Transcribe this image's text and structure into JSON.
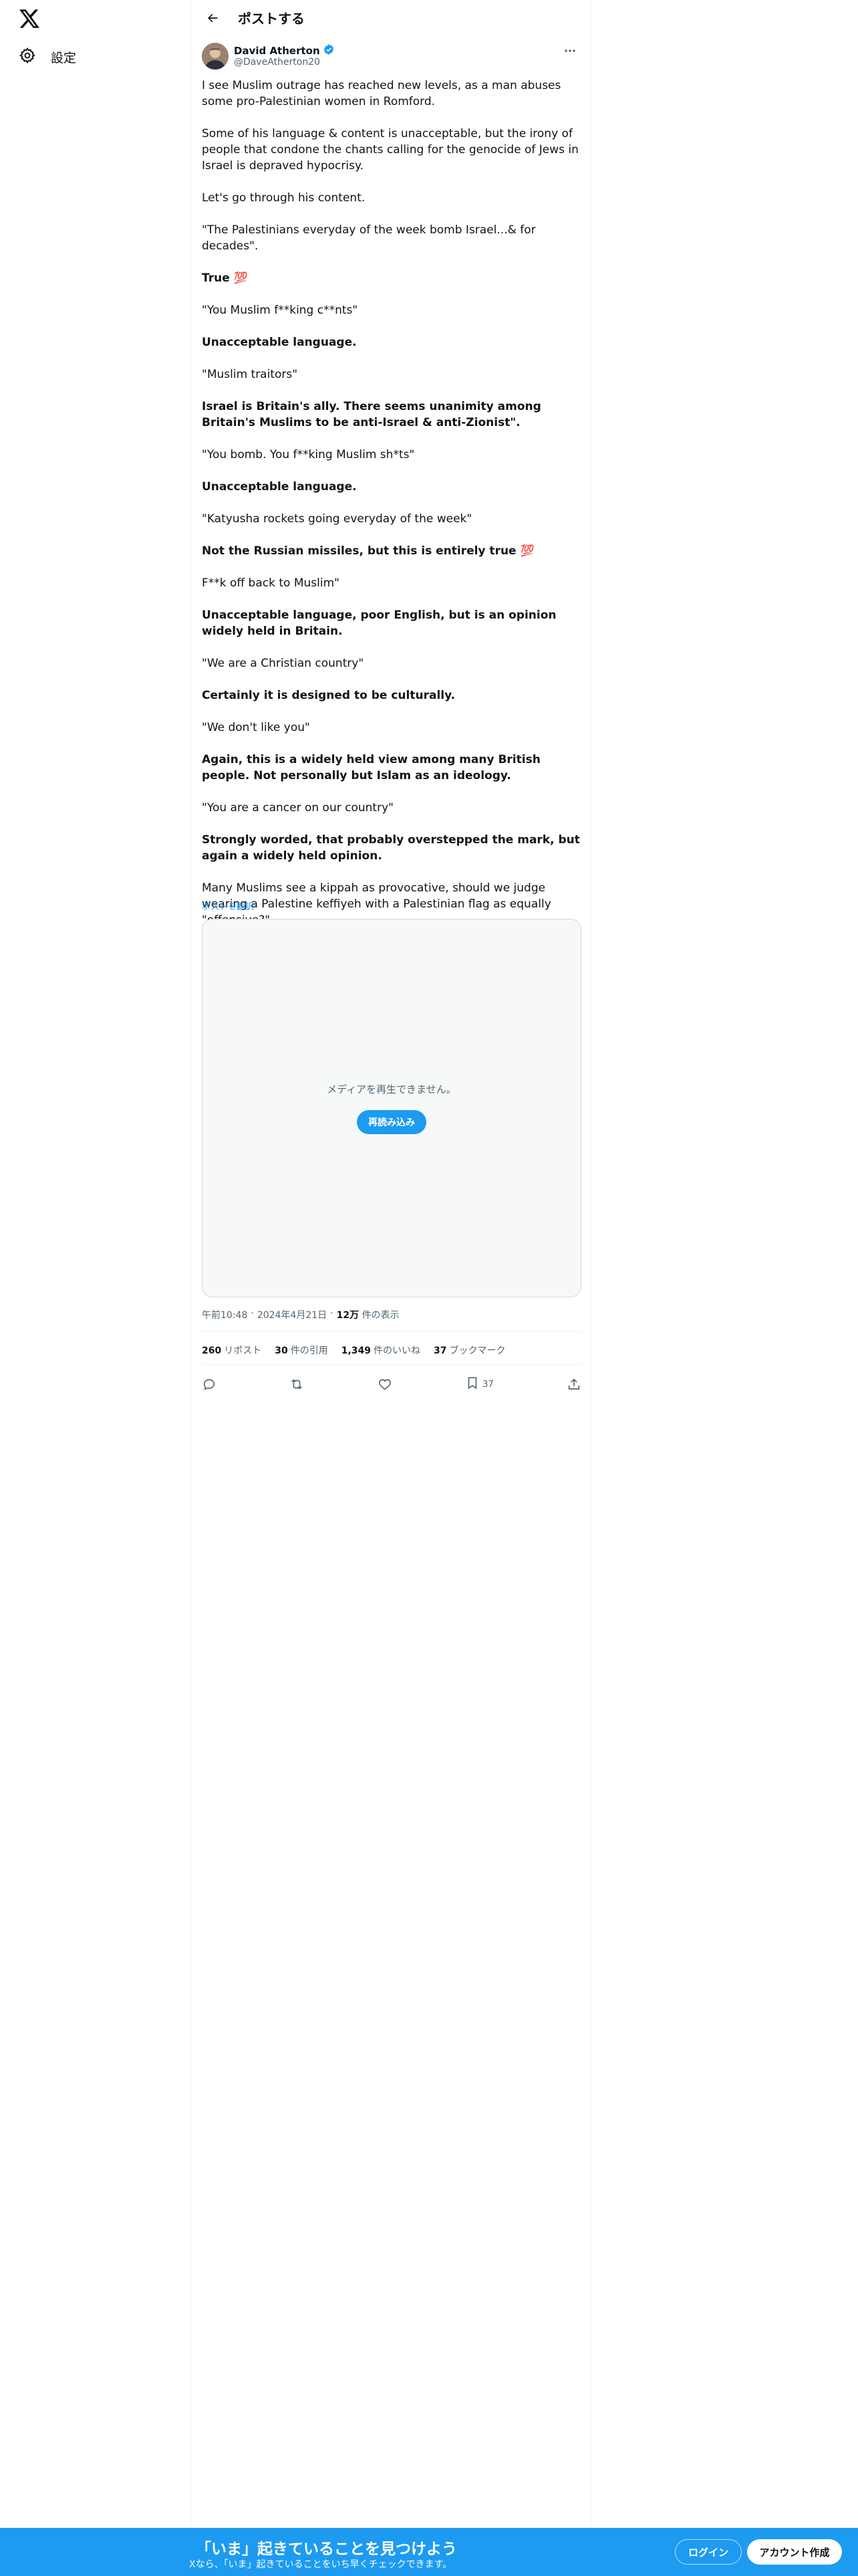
{
  "sidebar": {
    "settings_label": "設定"
  },
  "header": {
    "title": "ポストする"
  },
  "author": {
    "name": "David Atherton",
    "handle": "@DaveAtherton20"
  },
  "tweet": {
    "paragraphs": [
      {
        "text": "I see Muslim outrage has reached new levels, as a man abuses some pro-Palestinian women in Romford.",
        "bold": false
      },
      {
        "text": "Some of his language & content is unacceptable, but the irony of people that condone the chants calling for the genocide of Jews in Israel is depraved hypocrisy.",
        "bold": false
      },
      {
        "text": "Let's go through his content.",
        "bold": false
      },
      {
        "text": "\"The Palestinians everyday of the week bomb Israel...& for decades\".",
        "bold": false
      },
      {
        "text": "True 💯",
        "bold": true
      },
      {
        "text": "\"You Muslim f**king c**nts\"",
        "bold": false
      },
      {
        "text": "Unacceptable language.",
        "bold": true
      },
      {
        "text": "\"Muslim traitors\"",
        "bold": false
      },
      {
        "text": "Israel is Britain's ally. There seems unanimity among Britain's Muslims to be anti-Israel & anti-Zionist\".",
        "bold": true
      },
      {
        "text": "\"You bomb. You f**king Muslim sh*ts\"",
        "bold": false
      },
      {
        "text": "Unacceptable language.",
        "bold": true
      },
      {
        "text": "\"Katyusha rockets going everyday of the week\"",
        "bold": false
      },
      {
        "text": "Not the Russian missiles, but this is entirely true 💯",
        "bold": true
      },
      {
        "text": "F**k off back to Muslim\"",
        "bold": false
      },
      {
        "text": "Unacceptable language, poor English, but is an opinion widely held in Britain.",
        "bold": true
      },
      {
        "text": "\"We are a Christian country\"",
        "bold": false
      },
      {
        "text": "Certainly it is designed to be culturally.",
        "bold": true
      },
      {
        "text": "\"We don't like you\"",
        "bold": false
      },
      {
        "text": "Again, this is a widely held view among many British people. Not personally but Islam as an ideology.",
        "bold": true
      },
      {
        "text": "\"You are a cancer on our country\"",
        "bold": false
      },
      {
        "text": "Strongly worded, that probably overstepped the mark, but again a widely held opinion.",
        "bold": true
      },
      {
        "text": "Many Muslims see a kippah as provocative, should we judge wearing a Palestine keffiyeh with a Palestinian flag as equally \"offensive?\"",
        "bold": false
      }
    ],
    "translate_label": "ポストを翻訳"
  },
  "media": {
    "message": "メディアを再生できません。",
    "reload_label": "再読み込み"
  },
  "meta": {
    "time": "午前10:48",
    "date": "2024年4月21日",
    "views_count": "12万",
    "views_label": "件の表示"
  },
  "stats": {
    "reposts_count": "260",
    "reposts_label": "リポスト",
    "quotes_count": "30",
    "quotes_label": "件の引用",
    "likes_count": "1,349",
    "likes_label": "件のいいね",
    "bookmarks_count": "37",
    "bookmarks_label": "ブックマーク"
  },
  "actions": {
    "bookmark_count": "37"
  },
  "banner": {
    "title": "「いま」起きていることを見つけよう",
    "subtitle": "Xなら、「いま」起きていることをいち早くチェックできます。",
    "login_label": "ログイン",
    "signup_label": "アカウント作成"
  },
  "colors": {
    "accent": "#1d9bf0",
    "text": "#0f1419",
    "secondary": "#536471"
  }
}
